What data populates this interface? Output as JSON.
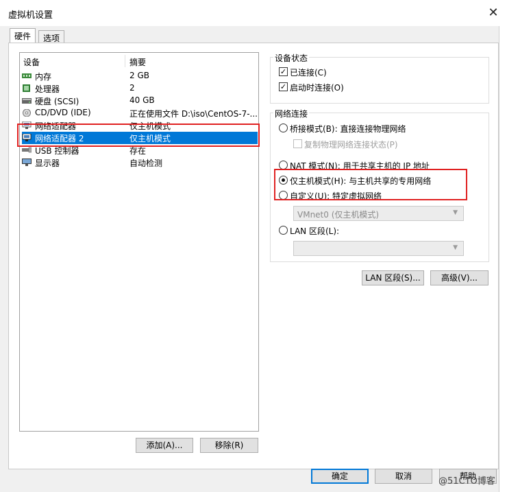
{
  "window": {
    "title": "虚拟机设置",
    "close_icon": "close-icon"
  },
  "tabs": [
    {
      "label": "硬件",
      "active": true
    },
    {
      "label": "选项",
      "active": false
    }
  ],
  "device_list": {
    "headers": {
      "device": "设备",
      "summary": "摘要"
    },
    "rows": [
      {
        "name": "内存",
        "summary": "2 GB",
        "icon": "memory-icon"
      },
      {
        "name": "处理器",
        "summary": "2",
        "icon": "cpu-icon"
      },
      {
        "name": "硬盘 (SCSI)",
        "summary": "40 GB",
        "icon": "harddisk-icon"
      },
      {
        "name": "CD/DVD (IDE)",
        "summary": "正在使用文件 D:\\iso\\CentOS-7-...",
        "icon": "cdrom-icon"
      },
      {
        "name": "网络适配器",
        "summary": "仅主机模式",
        "icon": "network-adapter-icon"
      },
      {
        "name": "网络适配器 2",
        "summary": "仅主机模式",
        "icon": "network-adapter-icon",
        "selected": true
      },
      {
        "name": "USB 控制器",
        "summary": "存在",
        "icon": "usb-icon"
      },
      {
        "name": "显示器",
        "summary": "自动检测",
        "icon": "monitor-icon"
      }
    ],
    "add_button": "添加(A)...",
    "remove_button": "移除(R)"
  },
  "device_status": {
    "label": "设备状态",
    "connected": {
      "label": "已连接(C)",
      "checked": true
    },
    "connect_at_power_on": {
      "label": "启动时连接(O)",
      "checked": true
    }
  },
  "network_connection": {
    "label": "网络连接",
    "bridged": {
      "label": "桥接模式(B): 直接连接物理网络",
      "selected": false
    },
    "replicate_state": {
      "label": "复制物理网络连接状态(P)",
      "checked": false,
      "disabled": true
    },
    "nat": {
      "label": "NAT 模式(N): 用于共享主机的 IP 地址",
      "selected": false
    },
    "host_only": {
      "label": "仅主机模式(H): 与主机共享的专用网络",
      "selected": true
    },
    "custom": {
      "label": "自定义(U): 特定虚拟网络",
      "selected": false
    },
    "custom_combo_value": "VMnet0 (仅主机模式)",
    "lan_segment": {
      "label": "LAN 区段(L):",
      "selected": false
    },
    "lan_combo_value": ""
  },
  "side_buttons": {
    "lan_segment": "LAN 区段(S)...",
    "advanced": "高级(V)..."
  },
  "footer": {
    "ok": "确定",
    "cancel": "取消",
    "help": "帮助"
  },
  "watermark": "@51CTO博客",
  "colors": {
    "selection": "#0078d7",
    "highlight_box": "#e02020"
  }
}
